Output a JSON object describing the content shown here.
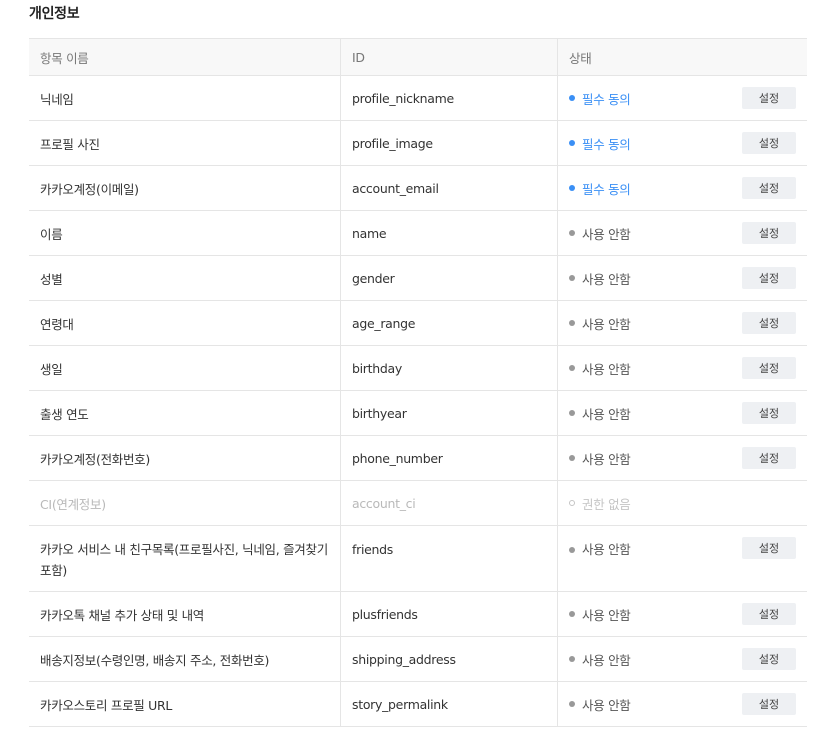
{
  "section_title": "개인정보",
  "table": {
    "headers": {
      "name": "항목 이름",
      "id": "ID",
      "status": "상태"
    },
    "setting_label": "설정",
    "rows": [
      {
        "name": "닉네임",
        "id": "profile_nickname",
        "status": "필수 동의",
        "status_type": "required",
        "has_button": true
      },
      {
        "name": "프로필 사진",
        "id": "profile_image",
        "status": "필수 동의",
        "status_type": "required",
        "has_button": true
      },
      {
        "name": "카카오계정(이메일)",
        "id": "account_email",
        "status": "필수 동의",
        "status_type": "required",
        "has_button": true
      },
      {
        "name": "이름",
        "id": "name",
        "status": "사용 안함",
        "status_type": "unused",
        "has_button": true
      },
      {
        "name": "성별",
        "id": "gender",
        "status": "사용 안함",
        "status_type": "unused",
        "has_button": true
      },
      {
        "name": "연령대",
        "id": "age_range",
        "status": "사용 안함",
        "status_type": "unused",
        "has_button": true
      },
      {
        "name": "생일",
        "id": "birthday",
        "status": "사용 안함",
        "status_type": "unused",
        "has_button": true
      },
      {
        "name": "출생 연도",
        "id": "birthyear",
        "status": "사용 안함",
        "status_type": "unused",
        "has_button": true
      },
      {
        "name": "카카오계정(전화번호)",
        "id": "phone_number",
        "status": "사용 안함",
        "status_type": "unused",
        "has_button": true
      },
      {
        "name": "CI(연계정보)",
        "id": "account_ci",
        "status": "권한 없음",
        "status_type": "none",
        "has_button": false
      },
      {
        "name": "카카오 서비스 내 친구목록(프로필사진, 닉네임, 즐겨찾기 포함)",
        "id": "friends",
        "status": "사용 안함",
        "status_type": "unused",
        "has_button": true
      },
      {
        "name": "카카오톡 채널 추가 상태 및 내역",
        "id": "plusfriends",
        "status": "사용 안함",
        "status_type": "unused",
        "has_button": true
      },
      {
        "name": "배송지정보(수령인명, 배송지 주소, 전화번호)",
        "id": "shipping_address",
        "status": "사용 안함",
        "status_type": "unused",
        "has_button": true
      },
      {
        "name": "카카오스토리 프로필 URL",
        "id": "story_permalink",
        "status": "사용 안함",
        "status_type": "unused",
        "has_button": true
      }
    ]
  },
  "colors": {
    "required": "#3a8ff5",
    "unused": "#999999",
    "none": "#c5c5c5"
  }
}
